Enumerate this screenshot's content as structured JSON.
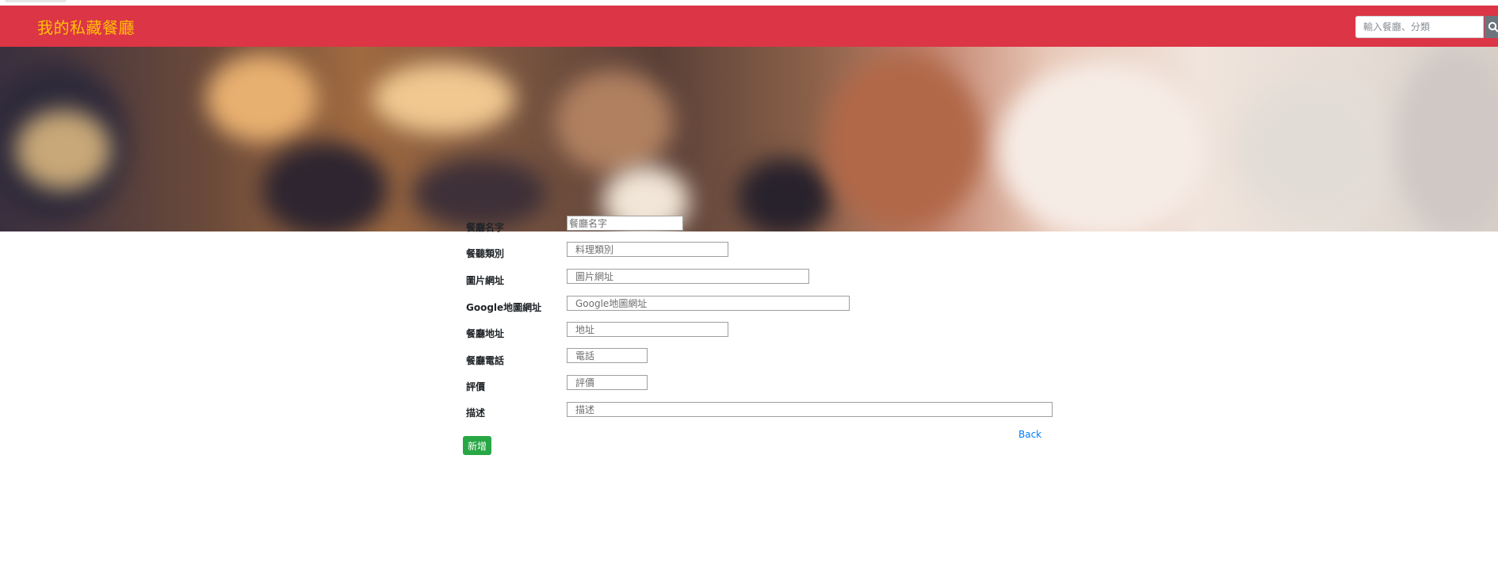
{
  "navbar": {
    "brand": "我的私藏餐廳",
    "search_placeholder": "輸入餐廳、分類",
    "search_icon": "search-icon"
  },
  "form": {
    "fields": [
      {
        "label": "餐廳名字",
        "placeholder": "餐廳名字"
      },
      {
        "label": "餐聽類別",
        "placeholder": "料理類別"
      },
      {
        "label": "圖片網址",
        "placeholder": "圖片網址"
      },
      {
        "label": "Google地圖網址",
        "placeholder": "Google地圖網址"
      },
      {
        "label": "餐廳地址",
        "placeholder": "地址"
      },
      {
        "label": "餐廳電話",
        "placeholder": "電話"
      },
      {
        "label": "評價",
        "placeholder": "評價"
      },
      {
        "label": "描述",
        "placeholder": "描述"
      }
    ],
    "back_label": "Back",
    "submit_label": "新增"
  },
  "colors": {
    "navbar": "#dc3545",
    "brand": "#ffc107",
    "submit": "#28a745",
    "link": "#007bff"
  }
}
